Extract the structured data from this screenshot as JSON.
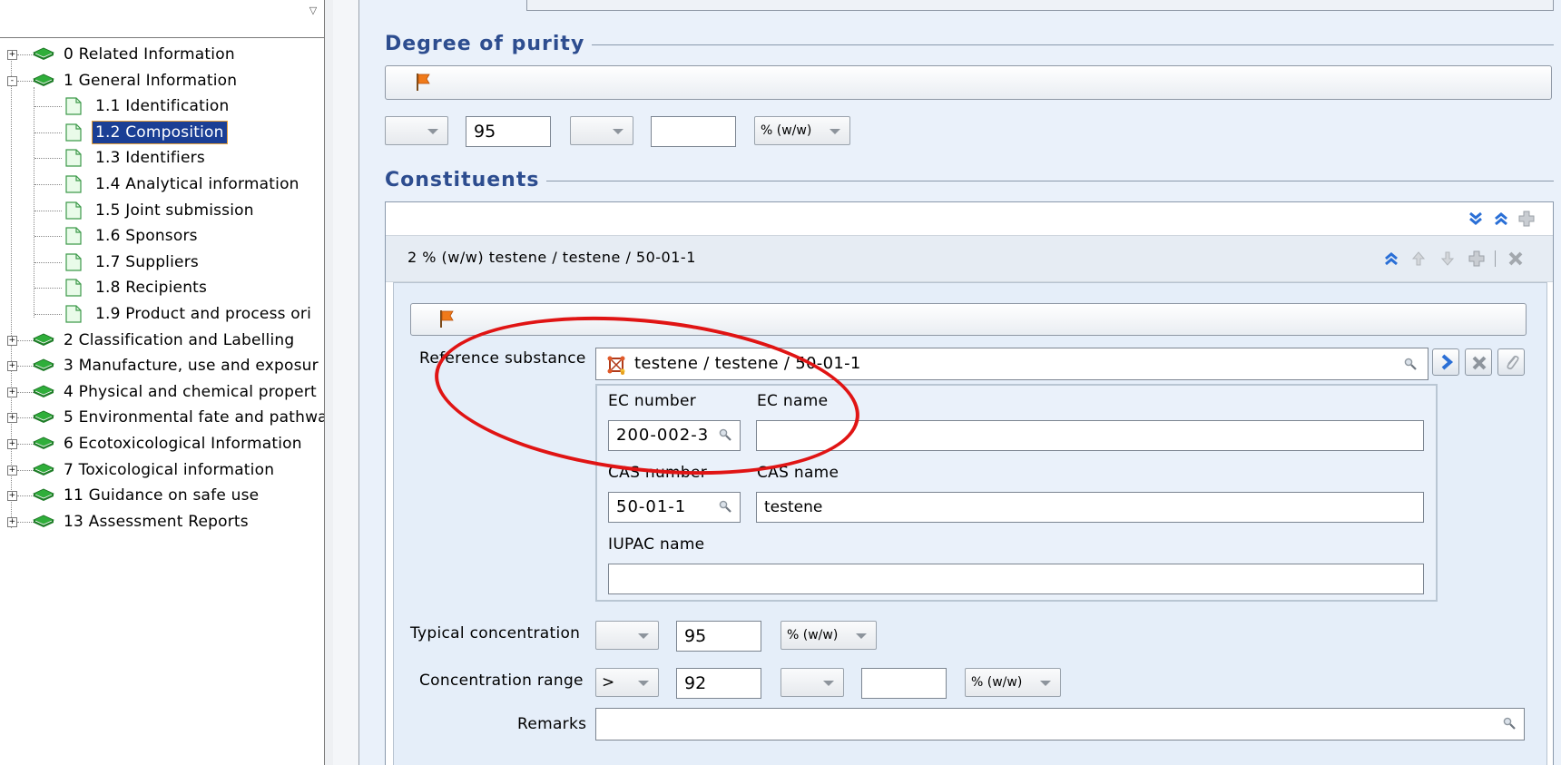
{
  "tree": {
    "items": [
      {
        "label": "0 Related Information",
        "level": 0,
        "expander": "+"
      },
      {
        "label": "1 General Information",
        "level": 0,
        "expander": "-"
      },
      {
        "label": "1.1 Identification",
        "level": 1
      },
      {
        "label": "1.2 Composition",
        "level": 1,
        "selected": true
      },
      {
        "label": "1.3 Identifiers",
        "level": 1
      },
      {
        "label": "1.4 Analytical information",
        "level": 1
      },
      {
        "label": "1.5 Joint submission",
        "level": 1
      },
      {
        "label": "1.6 Sponsors",
        "level": 1
      },
      {
        "label": "1.7 Suppliers",
        "level": 1
      },
      {
        "label": "1.8 Recipients",
        "level": 1
      },
      {
        "label": "1.9 Product and process ori",
        "level": 1
      },
      {
        "label": "2 Classification and Labelling",
        "level": 0,
        "expander": "+"
      },
      {
        "label": "3 Manufacture, use and exposur",
        "level": 0,
        "expander": "+"
      },
      {
        "label": "4 Physical and chemical propert",
        "level": 0,
        "expander": "+"
      },
      {
        "label": "5 Environmental fate and pathwa",
        "level": 0,
        "expander": "+"
      },
      {
        "label": "6 Ecotoxicological Information",
        "level": 0,
        "expander": "+"
      },
      {
        "label": "7 Toxicological information",
        "level": 0,
        "expander": "+"
      },
      {
        "label": "11 Guidance on safe use",
        "level": 0,
        "expander": "+"
      },
      {
        "label": "13 Assessment Reports",
        "level": 0,
        "expander": "+"
      }
    ]
  },
  "purity": {
    "title": "Degree of purity",
    "value": "95",
    "unit": "% (w/w)"
  },
  "constituents": {
    "title": "Constituents",
    "record_title": "2 % (w/w) testene / testene / 50-01-1",
    "reference_substance_label": "Reference substance",
    "reference_substance_value": "testene / testene / 50-01-1",
    "ec_number_label": "EC number",
    "ec_number_value": "200-002-3",
    "ec_name_label": "EC name",
    "ec_name_value": "",
    "cas_number_label": "CAS number",
    "cas_number_value": "50-01-1",
    "cas_name_label": "CAS name",
    "cas_name_value": "testene",
    "iupac_name_label": "IUPAC name",
    "iupac_name_value": "",
    "typical_concentration_label": "Typical concentration",
    "typical_concentration_value": "95",
    "typical_concentration_unit": "% (w/w)",
    "concentration_range_label": "Concentration range",
    "concentration_range_qualifier": ">",
    "concentration_range_value": "92",
    "concentration_range_unit": "% (w/w)",
    "remarks_label": "Remarks",
    "remarks_value": ""
  },
  "colors": {
    "selected_bg": "#1b3f95",
    "section_title": "#2d4d8f",
    "annotation": "#e01414",
    "nav_arrow": "#2a6fd6"
  }
}
